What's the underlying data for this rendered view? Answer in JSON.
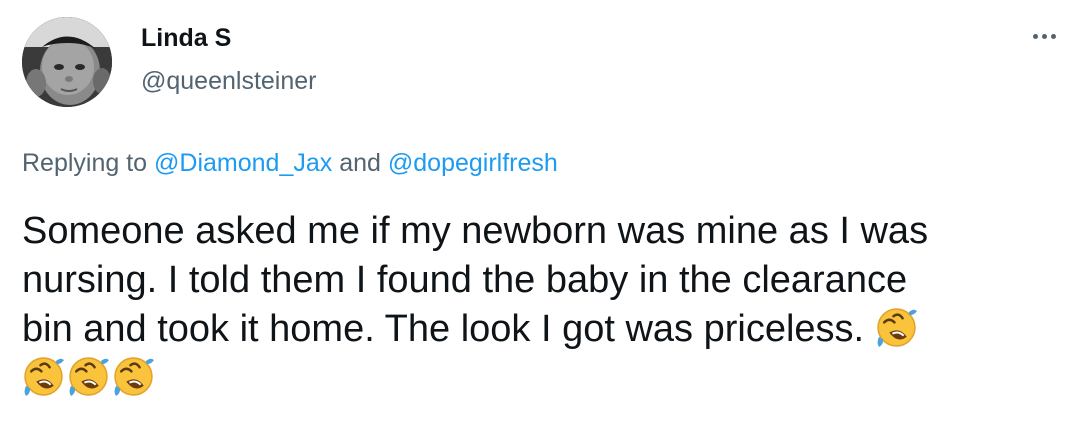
{
  "author": {
    "name": "Linda S",
    "handle": "@queenlsteiner",
    "avatar_icon": "baby-photo-avatar"
  },
  "more_icon": "more-options-icon",
  "reply_context": {
    "prefix": "Replying to ",
    "mention_1": "@Diamond_Jax",
    "conjunction": " and ",
    "mention_2": "@dopegirlfresh"
  },
  "tweet": {
    "line_1": "Someone asked me if my newborn was mine as I was",
    "line_2": "nursing. I told them I found the baby in the clearance",
    "line_3": "bin and took it home. The look I got was priceless. ",
    "emoji_icon": "rolling-on-the-floor-laughing-emoji",
    "emoji_count": 4
  },
  "colors": {
    "text_primary": "#0f1419",
    "text_secondary": "#536471",
    "link": "#1d9bf0",
    "emoji_face": "#f9c33c",
    "emoji_tears": "#4aa3df"
  }
}
